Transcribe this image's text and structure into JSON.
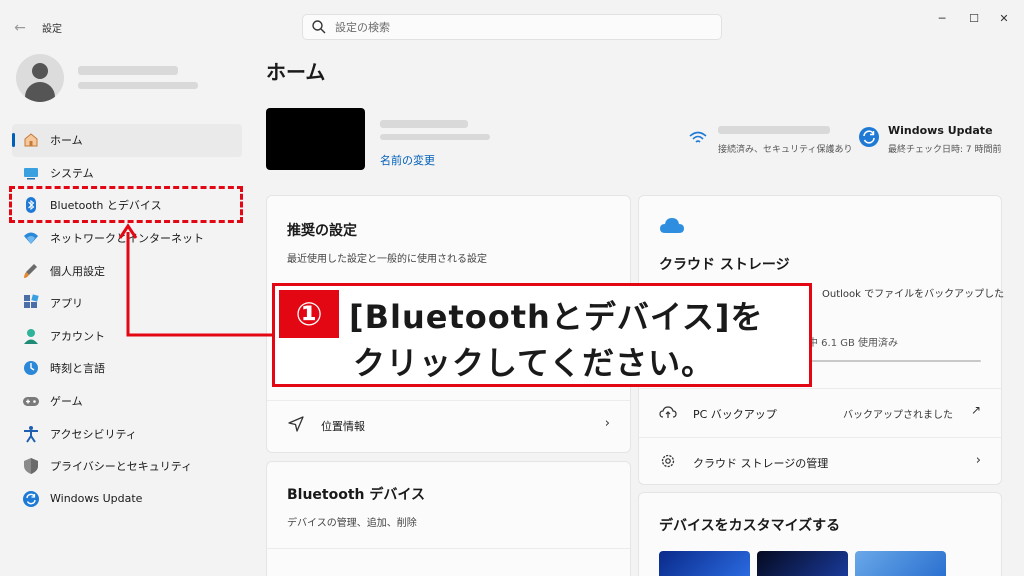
{
  "window": {
    "title": "設定",
    "controls": [
      "─",
      "☐",
      "✕"
    ]
  },
  "search": {
    "placeholder": "設定の検索",
    "value": ""
  },
  "sidebar": {
    "items": [
      {
        "label": "ホーム",
        "icon": "home-icon"
      },
      {
        "label": "システム",
        "icon": "system-icon"
      },
      {
        "label": "Bluetooth とデバイス",
        "icon": "bluetooth-icon"
      },
      {
        "label": "ネットワークとインターネット",
        "icon": "network-icon"
      },
      {
        "label": "個人用設定",
        "icon": "personalization-icon"
      },
      {
        "label": "アプリ",
        "icon": "apps-icon"
      },
      {
        "label": "アカウント",
        "icon": "accounts-icon"
      },
      {
        "label": "時刻と言語",
        "icon": "time-language-icon"
      },
      {
        "label": "ゲーム",
        "icon": "gaming-icon"
      },
      {
        "label": "アクセシビリティ",
        "icon": "accessibility-icon"
      },
      {
        "label": "プライバシーとセキュリティ",
        "icon": "privacy-icon"
      },
      {
        "label": "Windows Update",
        "icon": "windows-update-icon"
      }
    ]
  },
  "main": {
    "title": "ホーム",
    "device": {
      "rename_link": "名前の変更"
    },
    "wifi": {
      "status": "接続済み、セキュリティ保護あり"
    },
    "windows_update": {
      "title": "Windows Update",
      "subtitle": "最終チェック日時: 7 時間前"
    },
    "recommended": {
      "title": "推奨の設定",
      "subtitle": "最近使用した設定と一般的に使用される設定",
      "rows": [
        {
          "label": "位置情報"
        }
      ]
    },
    "bluetooth_card": {
      "title": "Bluetooth デバイス",
      "subtitle": "デバイスの管理、追加、削除"
    },
    "cloud_card": {
      "title": "クラウド ストレージ",
      "text": "Outlook でファイルをバックアップした",
      "storage": "中 6.1 GB 使用済み",
      "rows": [
        {
          "label": "PC バックアップ",
          "status": "バックアップされました"
        },
        {
          "label": "クラウド ストレージの管理"
        }
      ]
    },
    "customize_card": {
      "title": "デバイスをカスタマイズする"
    }
  },
  "annotation": {
    "number": "①",
    "line1": "[Bluetoothとデバイス]を",
    "line2": "クリックしてください。"
  },
  "colors": {
    "accent": "#005fb8",
    "highlight": "#e30613"
  }
}
